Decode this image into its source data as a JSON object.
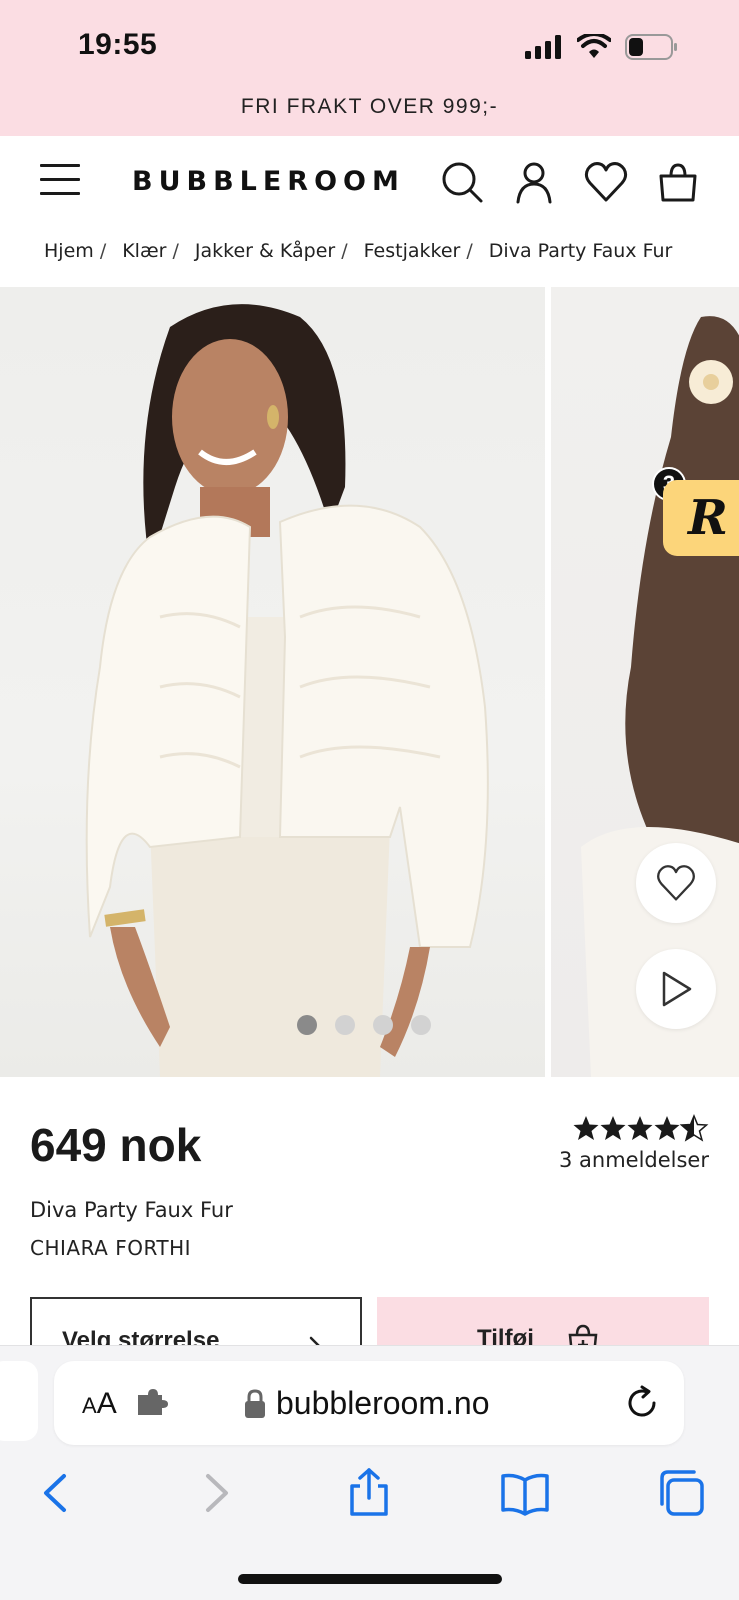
{
  "status_bar": {
    "time": "19:55",
    "battery_level": 0.35
  },
  "promo": {
    "text": "FRI FRAKT OVER 999;-"
  },
  "header": {
    "logo": "BUBBLEROOM",
    "icons": [
      "menu-icon",
      "search-icon",
      "account-icon",
      "heart-icon",
      "shopping-bag-icon"
    ]
  },
  "breadcrumb": {
    "items": [
      "Hjem",
      "Klær",
      "Jakker & Kåper",
      "Festjakker",
      "Diva Party Faux Fur"
    ],
    "separator": "/"
  },
  "gallery": {
    "dots_count": 4,
    "active_dot": 1,
    "rewards_badge": {
      "letter": "R",
      "count": "3"
    },
    "colors": {
      "badge": "#fcd57a"
    }
  },
  "product": {
    "price": "649 nok",
    "rating": 4.5,
    "reviews": "3 anmeldelser",
    "name": "Diva Party Faux Fur",
    "brand": "CHIARA FORTHI",
    "size_button": "Velg størrelse",
    "add_button": "Tilføj"
  },
  "browser": {
    "aa_small": "A",
    "aa_large": "A",
    "url": "bubbleroom.no"
  },
  "colors": {
    "accent_pink": "#fbdde3",
    "ios_blue": "#1a73e8",
    "text": "#1a1a1a"
  }
}
